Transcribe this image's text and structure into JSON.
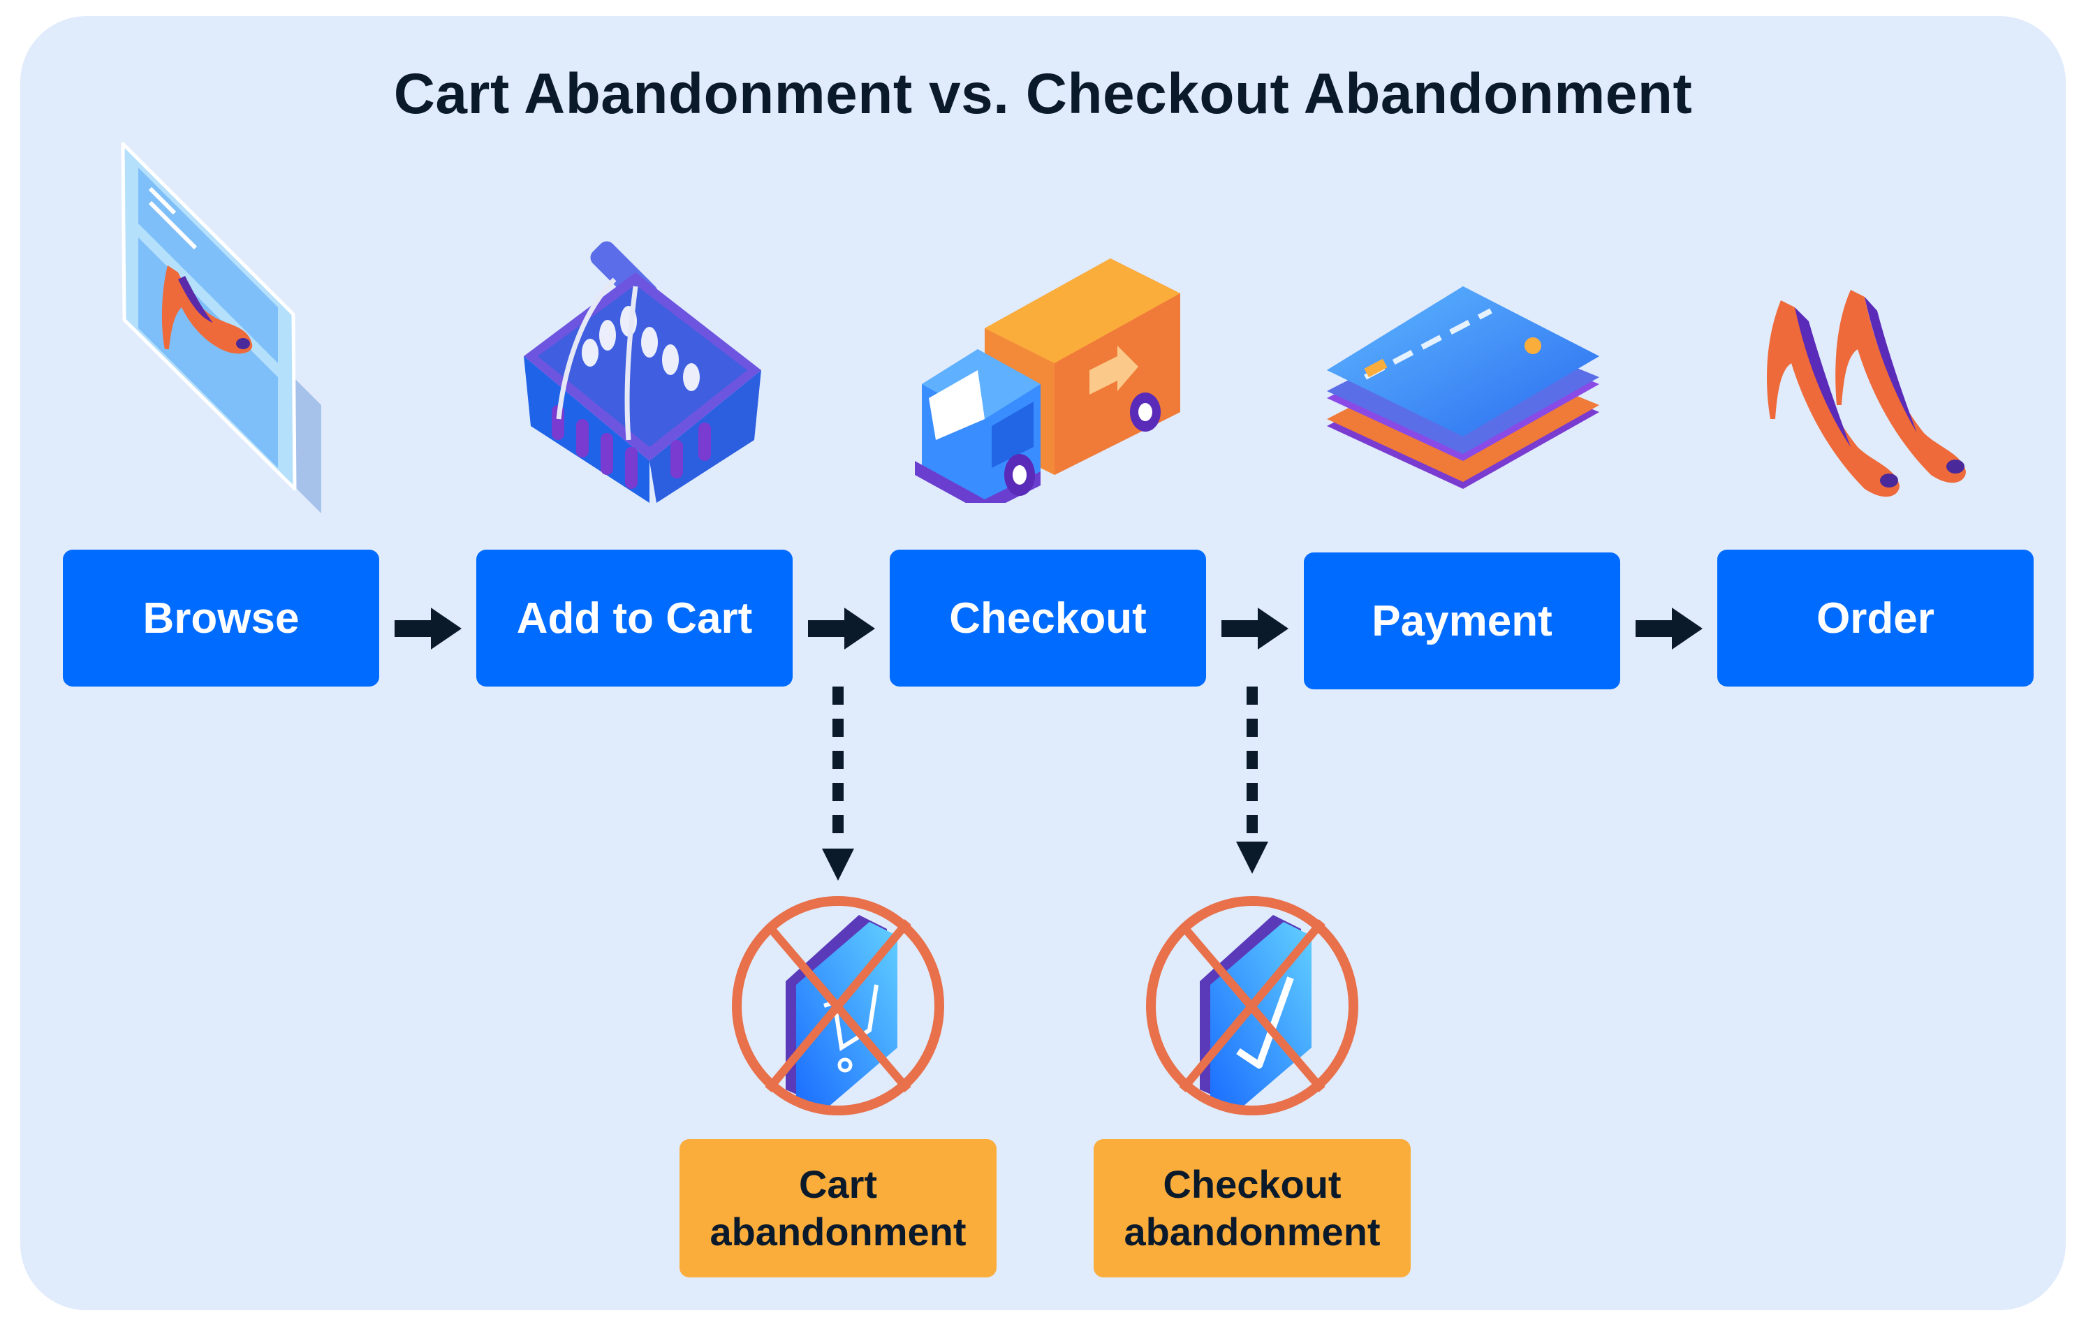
{
  "title": "Cart Abandonment vs. Checkout Abandonment",
  "colors": {
    "background": "#e0ebfc",
    "step_box": "#006bff",
    "outcome_box": "#fbad3c",
    "arrow": "#0b1a2b",
    "prohibited": "#e8704a"
  },
  "steps": [
    {
      "label": "Browse",
      "icon": "shoe-catalog-tablet-icon"
    },
    {
      "label": "Add to Cart",
      "icon": "shopping-basket-icon"
    },
    {
      "label": "Checkout",
      "icon": "delivery-truck-icon"
    },
    {
      "label": "Payment",
      "icon": "credit-cards-icon"
    },
    {
      "label": "Order",
      "icon": "high-heels-icon"
    }
  ],
  "outcomes": [
    {
      "line1": "Cart",
      "line2": "abandonment",
      "from_step": "Add to Cart",
      "icon": "prohibited-cart-icon"
    },
    {
      "line1": "Checkout",
      "line2": "abandonment",
      "from_step": "Checkout",
      "icon": "prohibited-checkmark-icon"
    }
  ]
}
